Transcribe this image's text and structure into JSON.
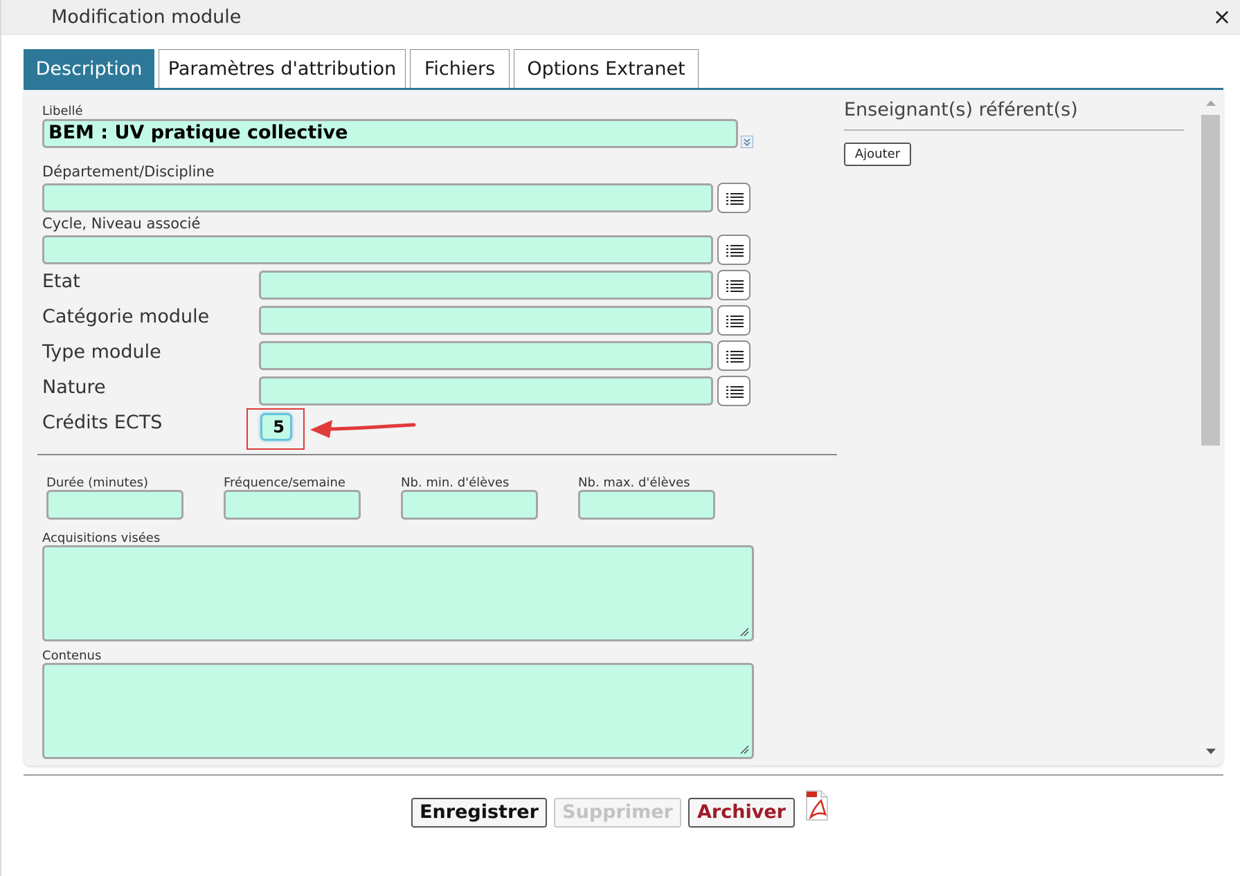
{
  "window": {
    "title": "Modification module",
    "close_icon": "×"
  },
  "tabs": [
    {
      "label": "Description",
      "active": true
    },
    {
      "label": "Paramètres d'attribution",
      "active": false
    },
    {
      "label": "Fichiers",
      "active": false
    },
    {
      "label": "Options Extranet",
      "active": false
    }
  ],
  "form": {
    "libelle": {
      "label": "Libellé",
      "value": "BEM : UV pratique collective"
    },
    "departement": {
      "label": "Département/Discipline",
      "value": ""
    },
    "cycle": {
      "label": "Cycle, Niveau associé",
      "value": ""
    },
    "etat": {
      "label": "Etat",
      "value": ""
    },
    "categorie": {
      "label": "Catégorie module",
      "value": ""
    },
    "type": {
      "label": "Type module",
      "value": ""
    },
    "nature": {
      "label": "Nature",
      "value": ""
    },
    "credits": {
      "label": "Crédits ECTS",
      "value": "5"
    },
    "duree": {
      "label": "Durée (minutes)",
      "value": ""
    },
    "frequence": {
      "label": "Fréquence/semaine",
      "value": ""
    },
    "nb_min": {
      "label": "Nb. min. d'élèves",
      "value": ""
    },
    "nb_max": {
      "label": "Nb. max. d'élèves",
      "value": ""
    },
    "acquisitions": {
      "label": "Acquisitions visées",
      "value": ""
    },
    "contenus": {
      "label": "Contenus",
      "value": ""
    }
  },
  "referents": {
    "title": "Enseignant(s) référent(s)",
    "add_label": "Ajouter"
  },
  "footer": {
    "save_label": "Enregistrer",
    "delete_label": "Supprimer",
    "archive_label": "Archiver"
  },
  "colors": {
    "field_bg": "#c3fae6",
    "tab_active": "#2d7898",
    "tab_underline": "#f07a20",
    "archive_text": "#9e1c28",
    "highlight": "#e03a3a"
  }
}
